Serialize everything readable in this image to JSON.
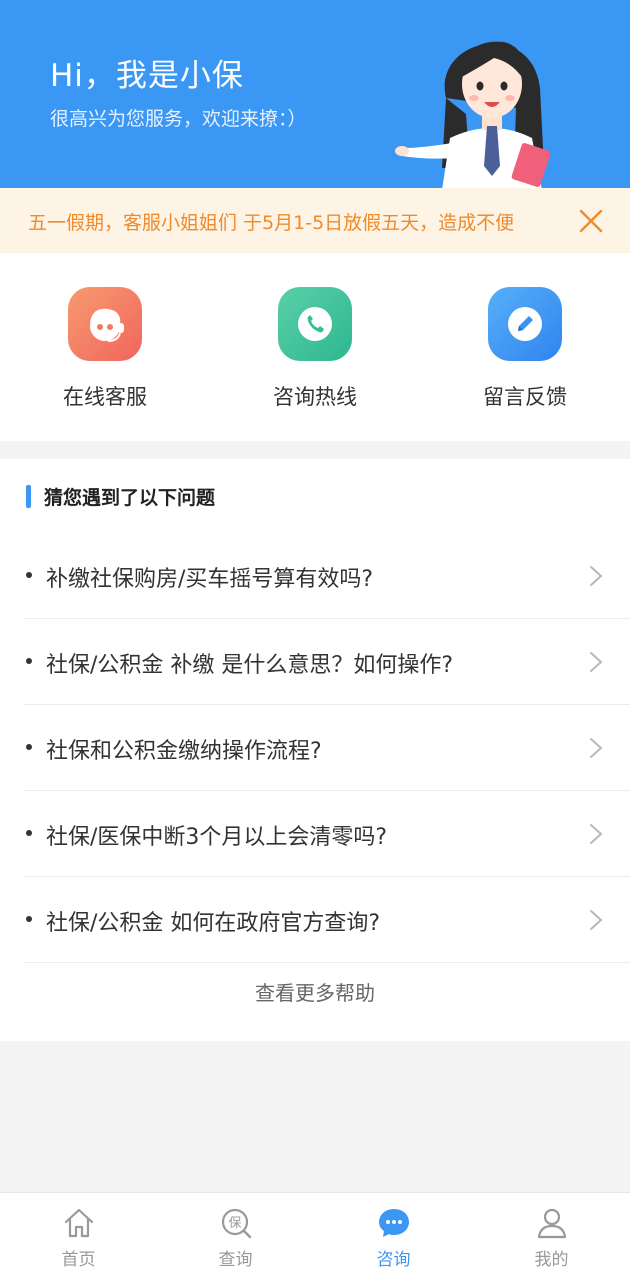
{
  "header": {
    "title": "Hi，我是小保",
    "subtitle": "很高兴为您服务，欢迎来撩：）"
  },
  "notice": {
    "text": "五一假期，客服小姐姐们 于5月1-5日放假五天，造成不便"
  },
  "services": [
    {
      "label": "在线客服",
      "icon": "robot-agent-icon",
      "color": "#f4795f"
    },
    {
      "label": "咨询热线",
      "icon": "phone-icon",
      "color": "#37c29c"
    },
    {
      "label": "留言反馈",
      "icon": "edit-pen-icon",
      "color": "#3a93f3"
    }
  ],
  "faq": {
    "title": "猜您遇到了以下问题",
    "items": [
      "补缴社保购房/买车摇号算有效吗?",
      "社保/公积金 补缴 是什么意思？如何操作?",
      "社保和公积金缴纳操作流程?",
      "社保/医保中断3个月以上会清零吗?",
      "社保/公积金 如何在政府官方查询?"
    ],
    "more": "查看更多帮助"
  },
  "tabs": [
    {
      "label": "首页",
      "icon": "home-icon",
      "active": false
    },
    {
      "label": "查询",
      "icon": "bao-search-icon",
      "active": false
    },
    {
      "label": "咨询",
      "icon": "chat-bubble-icon",
      "active": true
    },
    {
      "label": "我的",
      "icon": "user-icon",
      "active": false
    }
  ],
  "colors": {
    "primary": "#3b97f4",
    "notice_bg": "#fdf4e6",
    "notice_text": "#f08a2a"
  }
}
